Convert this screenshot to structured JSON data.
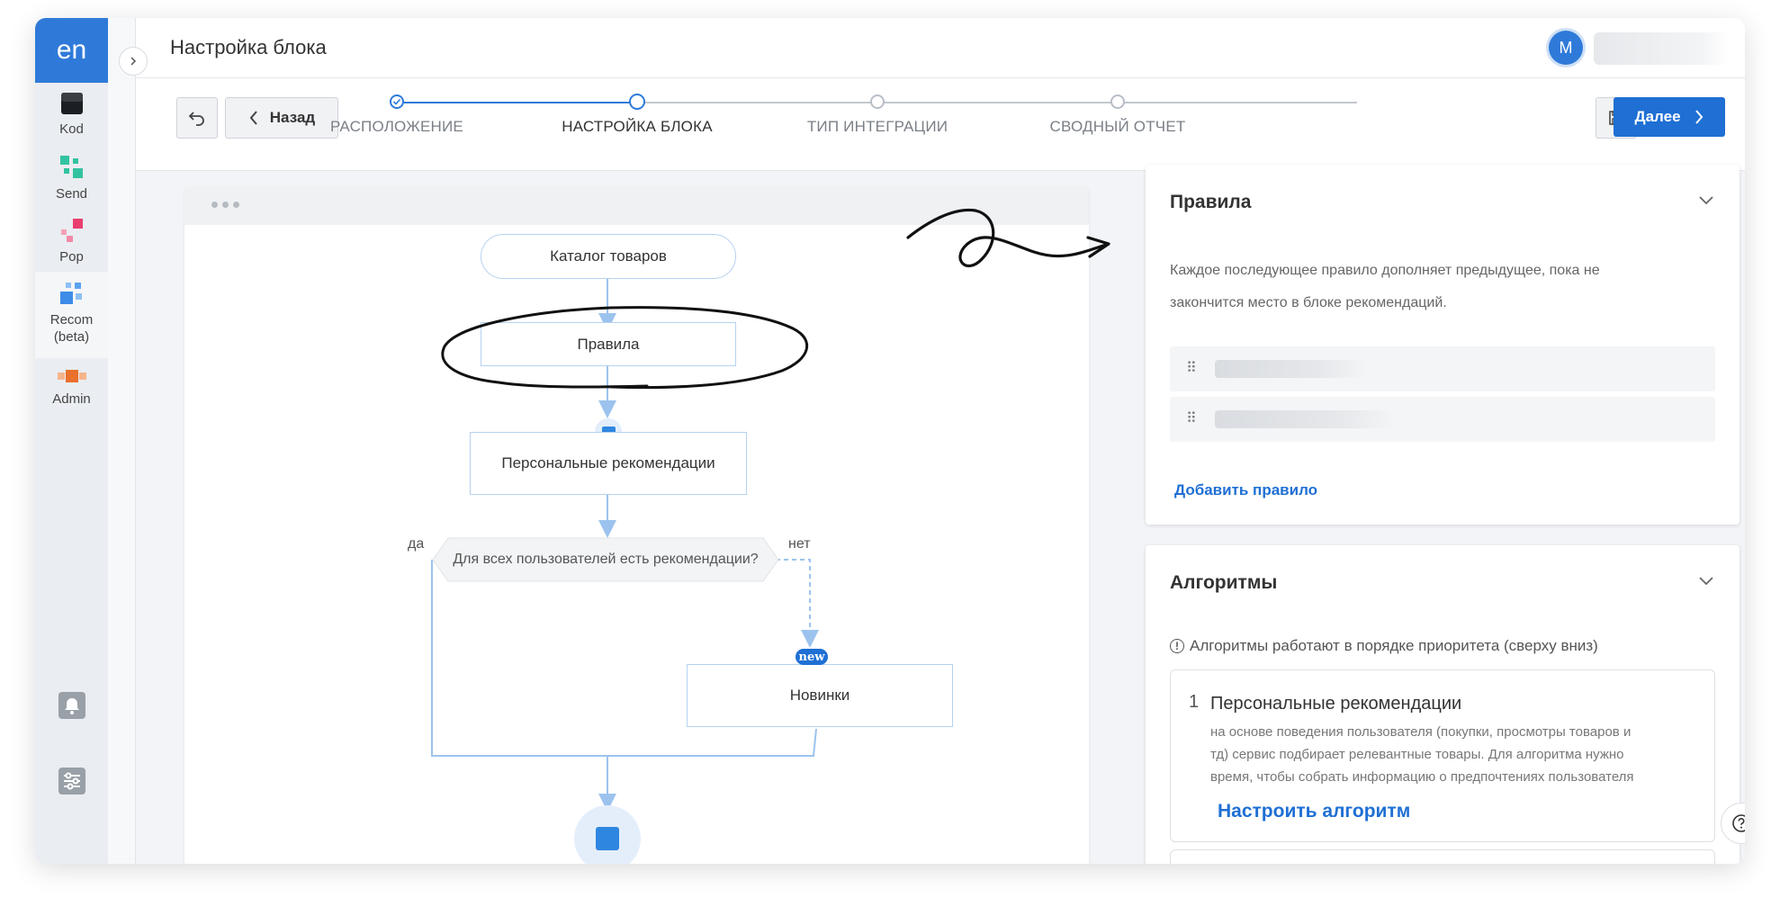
{
  "app": {
    "logo_text": "en"
  },
  "nav": {
    "items": [
      {
        "label": "Kod",
        "icon": "kod-icon"
      },
      {
        "label": "Send",
        "icon": "send-icon"
      },
      {
        "label": "Pop",
        "icon": "pop-icon"
      },
      {
        "label": "Recom\n(beta)",
        "icon": "recom-icon"
      },
      {
        "label": "Admin",
        "icon": "admin-icon"
      }
    ],
    "bottom": [
      {
        "icon": "bell-icon"
      },
      {
        "icon": "settings-sliders-icon"
      }
    ]
  },
  "header": {
    "title": "Настройка блока",
    "avatar_initial": "M"
  },
  "toolbar": {
    "back_label": "Назад",
    "next_label": "Далее"
  },
  "steps": [
    {
      "label": "РАСПОЛОЖЕНИЕ",
      "state": "done"
    },
    {
      "label": "НАСТРОЙКА БЛОКА",
      "state": "current"
    },
    {
      "label": "ТИП ИНТЕГРАЦИИ",
      "state": "pending"
    },
    {
      "label": "СВОДНЫЙ ОТЧЕТ",
      "state": "pending"
    }
  ],
  "flow": {
    "catalog": "Каталог товаров",
    "rules": "Правила",
    "personal": "Персональные рекомендации",
    "condition": "Для всех пользователей есть рекомендации?",
    "yes": "да",
    "no": "нет",
    "new_badge": "new",
    "new_items": "Новинки"
  },
  "rules_panel": {
    "title": "Правила",
    "description_line1": "Каждое последующее правило дополняет предыдущее, пока не",
    "description_line2": "закончится место в блоке рекомендаций.",
    "add_rule": "Добавить правило"
  },
  "algo_panel": {
    "title": "Алгоритмы",
    "info": "Алгоритмы работают в порядке приоритета (сверху вниз)",
    "items": [
      {
        "index": "1",
        "title": "Персональные рекомендации",
        "desc_line1": "на основе поведения пользователя (покупки, просмотры товаров и",
        "desc_line2": "тд) сервис подбирает релевантные товары. Для алгоритма нужно",
        "desc_line3": "время, чтобы собрать информацию о предпочтениях пользователя",
        "action": "Настроить алгоритм"
      }
    ]
  },
  "colors": {
    "accent": "#1f6fd4",
    "node_border": "#b5d2f1",
    "connector": "#9cc3ee"
  }
}
